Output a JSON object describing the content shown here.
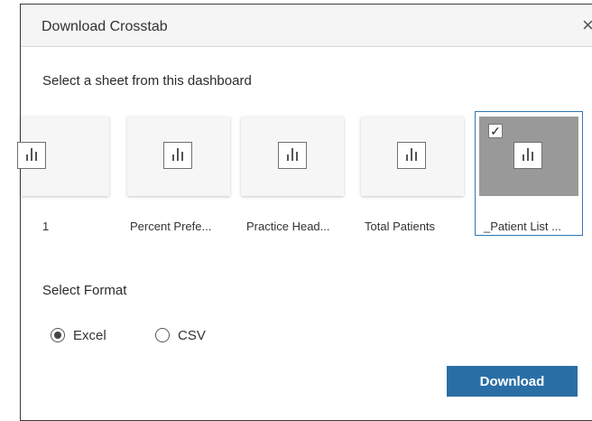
{
  "dialog": {
    "title": "Download Crosstab",
    "close_glyph": "×",
    "sheet_prompt": "Select a sheet from this dashboard",
    "sheets": [
      {
        "label": "1",
        "selected": false,
        "icon": "bar-chart-icon"
      },
      {
        "label": "Percent Prefe...",
        "selected": false,
        "icon": "bar-chart-icon"
      },
      {
        "label": "Practice Head...",
        "selected": false,
        "icon": "bar-chart-icon"
      },
      {
        "label": "Total Patients",
        "selected": false,
        "icon": "bar-chart-icon"
      },
      {
        "label": "_Patient List ...",
        "selected": true,
        "icon": "bar-chart-icon",
        "check_glyph": "✓"
      }
    ],
    "format_label": "Select Format",
    "formats": [
      {
        "label": "Excel",
        "selected": true
      },
      {
        "label": "CSV",
        "selected": false
      }
    ],
    "download_label": "Download",
    "colors": {
      "accent": "#2a6ea6",
      "selected_thumb": "#999999",
      "selection_border": "#2f78b8",
      "header_bg": "#f5f5f5"
    }
  }
}
